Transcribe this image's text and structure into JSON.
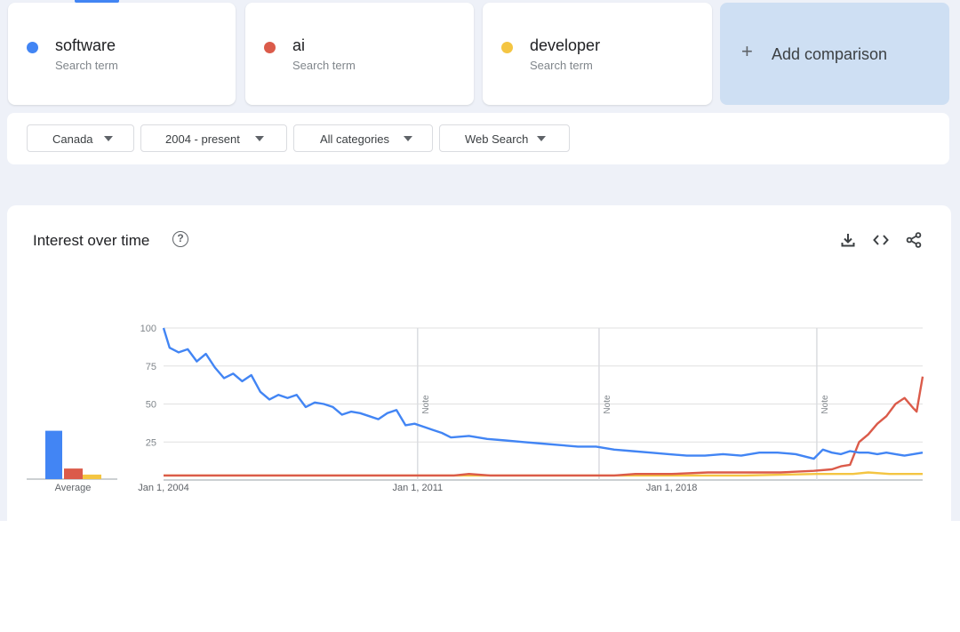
{
  "terms": [
    {
      "name": "software",
      "sub": "Search term",
      "color": "#4285f4"
    },
    {
      "name": "ai",
      "sub": "Search term",
      "color": "#db5b4a"
    },
    {
      "name": "developer",
      "sub": "Search term",
      "color": "#f4c542"
    }
  ],
  "add_comparison": {
    "plus": "+",
    "label": "Add comparison"
  },
  "filters": {
    "region": "Canada",
    "time": "2004 - present",
    "category": "All categories",
    "search_type": "Web Search"
  },
  "chart_card": {
    "title": "Interest over time",
    "help_glyph": "?",
    "actions": [
      "download-icon",
      "embed-code-icon",
      "share-icon"
    ]
  },
  "chart_data": {
    "type": "line",
    "title": "",
    "xlabel": "",
    "ylabel": "",
    "x_range": [
      "2004-01",
      "2024-12"
    ],
    "ylim": [
      0,
      100
    ],
    "y_ticks": [
      100,
      75,
      50,
      25
    ],
    "x_tick_labels": [
      {
        "label": "Jan 1, 2004",
        "date": "2004-01"
      },
      {
        "label": "Jan 1, 2011",
        "date": "2011-01"
      },
      {
        "label": "Jan 1, 2018",
        "date": "2018-01"
      }
    ],
    "notes": [
      {
        "label": "Note",
        "date": "2011-01"
      },
      {
        "label": "Note",
        "date": "2016-01"
      },
      {
        "label": "Note",
        "date": "2022-01"
      }
    ],
    "grid": true,
    "series": [
      {
        "name": "software",
        "color": "#4285f4",
        "points": [
          [
            "2004-01",
            100
          ],
          [
            "2004-03",
            87
          ],
          [
            "2004-06",
            84
          ],
          [
            "2004-09",
            86
          ],
          [
            "2004-12",
            78
          ],
          [
            "2005-03",
            83
          ],
          [
            "2005-06",
            74
          ],
          [
            "2005-09",
            67
          ],
          [
            "2005-12",
            70
          ],
          [
            "2006-03",
            65
          ],
          [
            "2006-06",
            69
          ],
          [
            "2006-09",
            58
          ],
          [
            "2006-12",
            53
          ],
          [
            "2007-03",
            56
          ],
          [
            "2007-06",
            54
          ],
          [
            "2007-09",
            56
          ],
          [
            "2007-12",
            48
          ],
          [
            "2008-03",
            51
          ],
          [
            "2008-06",
            50
          ],
          [
            "2008-09",
            48
          ],
          [
            "2008-12",
            43
          ],
          [
            "2009-03",
            45
          ],
          [
            "2009-06",
            44
          ],
          [
            "2009-09",
            42
          ],
          [
            "2009-12",
            40
          ],
          [
            "2010-03",
            44
          ],
          [
            "2010-06",
            46
          ],
          [
            "2010-09",
            36
          ],
          [
            "2010-12",
            37
          ],
          [
            "2011-03",
            35
          ],
          [
            "2011-06",
            33
          ],
          [
            "2011-09",
            31
          ],
          [
            "2011-12",
            28
          ],
          [
            "2012-06",
            29
          ],
          [
            "2012-12",
            27
          ],
          [
            "2013-06",
            26
          ],
          [
            "2013-12",
            25
          ],
          [
            "2014-06",
            24
          ],
          [
            "2014-12",
            23
          ],
          [
            "2015-06",
            22
          ],
          [
            "2015-12",
            22
          ],
          [
            "2016-06",
            20
          ],
          [
            "2016-12",
            19
          ],
          [
            "2017-06",
            18
          ],
          [
            "2017-12",
            17
          ],
          [
            "2018-06",
            16
          ],
          [
            "2018-12",
            16
          ],
          [
            "2019-06",
            17
          ],
          [
            "2019-12",
            16
          ],
          [
            "2020-06",
            18
          ],
          [
            "2020-12",
            18
          ],
          [
            "2021-06",
            17
          ],
          [
            "2021-12",
            14
          ],
          [
            "2022-03",
            20
          ],
          [
            "2022-06",
            18
          ],
          [
            "2022-09",
            17
          ],
          [
            "2022-12",
            19
          ],
          [
            "2023-03",
            18
          ],
          [
            "2023-06",
            18
          ],
          [
            "2023-09",
            17
          ],
          [
            "2023-12",
            18
          ],
          [
            "2024-03",
            17
          ],
          [
            "2024-06",
            16
          ],
          [
            "2024-12",
            18
          ]
        ]
      },
      {
        "name": "ai",
        "color": "#db5b4a",
        "points": [
          [
            "2004-01",
            3
          ],
          [
            "2006-01",
            3
          ],
          [
            "2008-01",
            3
          ],
          [
            "2010-01",
            3
          ],
          [
            "2011-01",
            3
          ],
          [
            "2012-01",
            3
          ],
          [
            "2012-06",
            4
          ],
          [
            "2013-01",
            3
          ],
          [
            "2014-01",
            3
          ],
          [
            "2015-01",
            3
          ],
          [
            "2016-01",
            3
          ],
          [
            "2016-06",
            3
          ],
          [
            "2017-01",
            4
          ],
          [
            "2018-01",
            4
          ],
          [
            "2019-01",
            5
          ],
          [
            "2020-01",
            5
          ],
          [
            "2021-01",
            5
          ],
          [
            "2021-12",
            6
          ],
          [
            "2022-06",
            7
          ],
          [
            "2022-09",
            9
          ],
          [
            "2022-12",
            10
          ],
          [
            "2023-01",
            15
          ],
          [
            "2023-03",
            25
          ],
          [
            "2023-06",
            30
          ],
          [
            "2023-09",
            37
          ],
          [
            "2023-12",
            42
          ],
          [
            "2024-03",
            50
          ],
          [
            "2024-06",
            54
          ],
          [
            "2024-09",
            47
          ],
          [
            "2024-10",
            45
          ],
          [
            "2024-12",
            68
          ]
        ]
      },
      {
        "name": "developer",
        "color": "#f4c542",
        "points": [
          [
            "2004-01",
            3
          ],
          [
            "2008-01",
            3
          ],
          [
            "2012-01",
            3
          ],
          [
            "2016-01",
            3
          ],
          [
            "2018-01",
            3
          ],
          [
            "2020-01",
            3
          ],
          [
            "2022-01",
            4
          ],
          [
            "2023-01",
            4
          ],
          [
            "2023-06",
            5
          ],
          [
            "2024-01",
            4
          ],
          [
            "2024-12",
            4
          ]
        ]
      }
    ],
    "average": {
      "label": "Average",
      "values": [
        {
          "name": "software",
          "value": 32
        },
        {
          "name": "ai",
          "value": 7
        },
        {
          "name": "developer",
          "value": 3
        }
      ]
    }
  }
}
